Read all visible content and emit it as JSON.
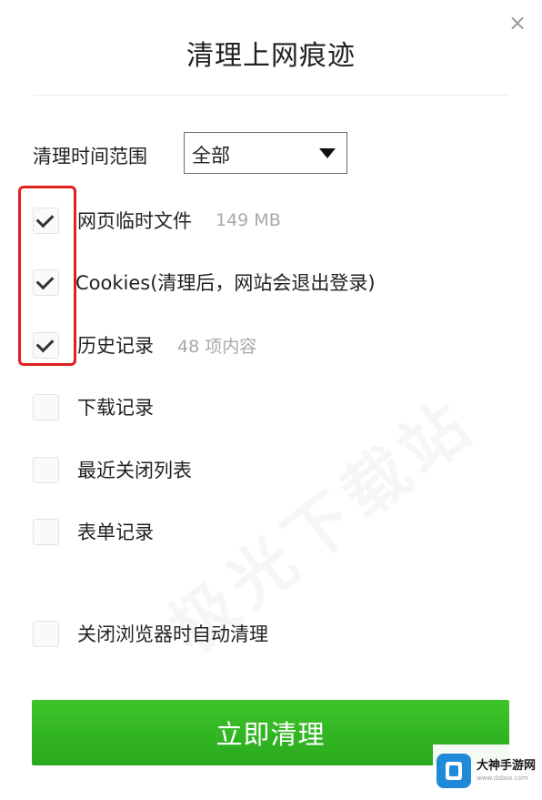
{
  "dialog": {
    "title": "清理上网痕迹",
    "close_glyph": "×"
  },
  "time_range": {
    "label": "清理时间范围",
    "selected": "全部"
  },
  "options": [
    {
      "label": "网页临时文件",
      "meta": "149 MB",
      "checked": true
    },
    {
      "label": "Cookies(清理后，网站会退出登录)",
      "meta": "",
      "checked": true
    },
    {
      "label": "历史记录",
      "meta": "48 项内容",
      "checked": true
    },
    {
      "label": "下载记录",
      "meta": "",
      "checked": false
    },
    {
      "label": "最近关闭列表",
      "meta": "",
      "checked": false
    },
    {
      "label": "表单记录",
      "meta": "",
      "checked": false
    },
    {
      "label": "关闭浏览器时自动清理",
      "meta": "",
      "checked": false
    }
  ],
  "action": {
    "clean_label": "立即清理"
  },
  "watermark": {
    "text": "极光下载站"
  },
  "badge": {
    "name": "大神手游网",
    "url": "www.dsbox.com"
  },
  "colors": {
    "accent_green": "#2fb322",
    "highlight_red": "#e0211d"
  }
}
